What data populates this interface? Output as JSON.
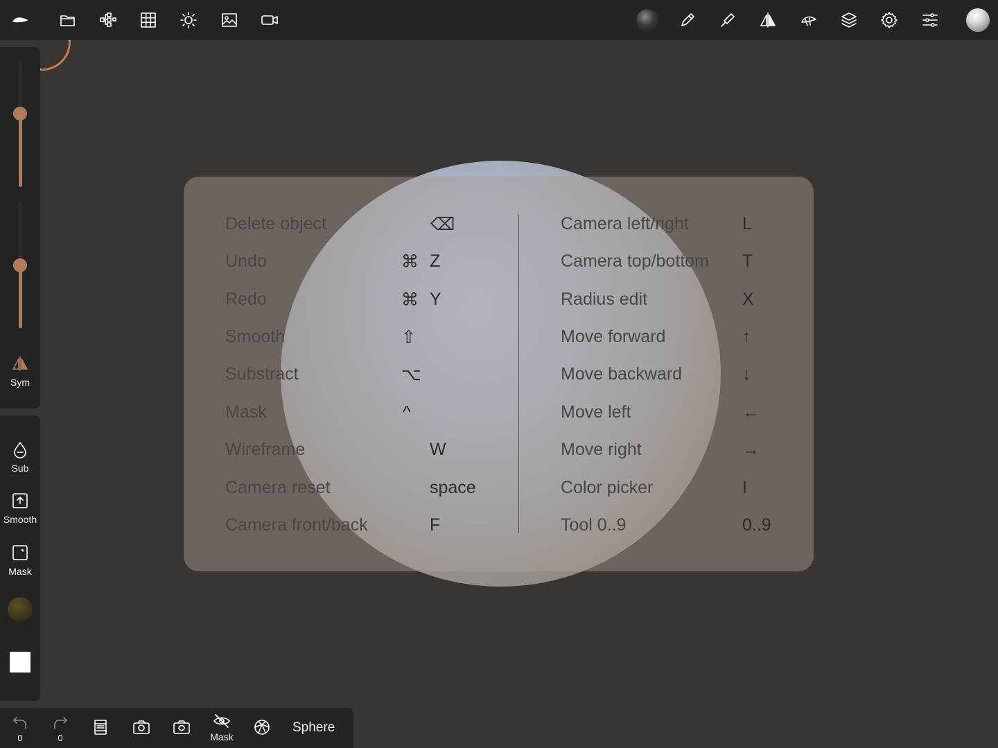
{
  "topbar": {
    "icons": [
      "logo-icon",
      "folder-icon",
      "scene-tree-icon",
      "grid-icon",
      "light-icon",
      "image-icon",
      "camera-video-icon",
      "matcap-dark-icon",
      "pencil-icon",
      "brush-icon",
      "symmetry-icon",
      "topology-icon",
      "layers-icon",
      "settings-icon",
      "sliders-icon",
      "matcap-light-icon"
    ]
  },
  "left_panel": {
    "sym_label": "Sym",
    "sub_label": "Sub",
    "smooth_label": "Smooth",
    "mask_label": "Mask",
    "slider1_level": 0.6,
    "slider2_level": 0.5
  },
  "bottom_bar": {
    "undo_count": "0",
    "redo_count": "0",
    "mask_label": "Mask",
    "primitive_label": "Sphere"
  },
  "shortcuts": {
    "left": [
      {
        "name": "Delete object",
        "key": "⌫",
        "mod": ""
      },
      {
        "name": "Undo",
        "key": "Z",
        "mod": "⌘"
      },
      {
        "name": "Redo",
        "key": "Y",
        "mod": "⌘"
      },
      {
        "name": "Smooth",
        "key": "",
        "mod": "⇧"
      },
      {
        "name": "Substract",
        "key": "",
        "mod": "⌥"
      },
      {
        "name": "Mask",
        "key": "",
        "mod": "^"
      },
      {
        "name": "Wireframe",
        "key": "W",
        "mod": ""
      },
      {
        "name": "Camera reset",
        "key": "space",
        "mod": ""
      },
      {
        "name": "Camera front/back",
        "key": "F",
        "mod": ""
      }
    ],
    "right": [
      {
        "name": "Camera left/right",
        "key": "L"
      },
      {
        "name": "Camera top/bottom",
        "key": "T"
      },
      {
        "name": "Radius edit",
        "key": "X"
      },
      {
        "name": "Move forward",
        "key": "↑"
      },
      {
        "name": "Move backward",
        "key": "↓"
      },
      {
        "name": "Move left",
        "key": "←"
      },
      {
        "name": "Move right",
        "key": "→"
      },
      {
        "name": "Color picker",
        "key": "I"
      },
      {
        "name": "Tool 0..9",
        "key": "0..9"
      }
    ]
  },
  "colors": {
    "accent": "#b07a5c",
    "bar_bg": "#232323",
    "viewport_bg": "#393532"
  }
}
